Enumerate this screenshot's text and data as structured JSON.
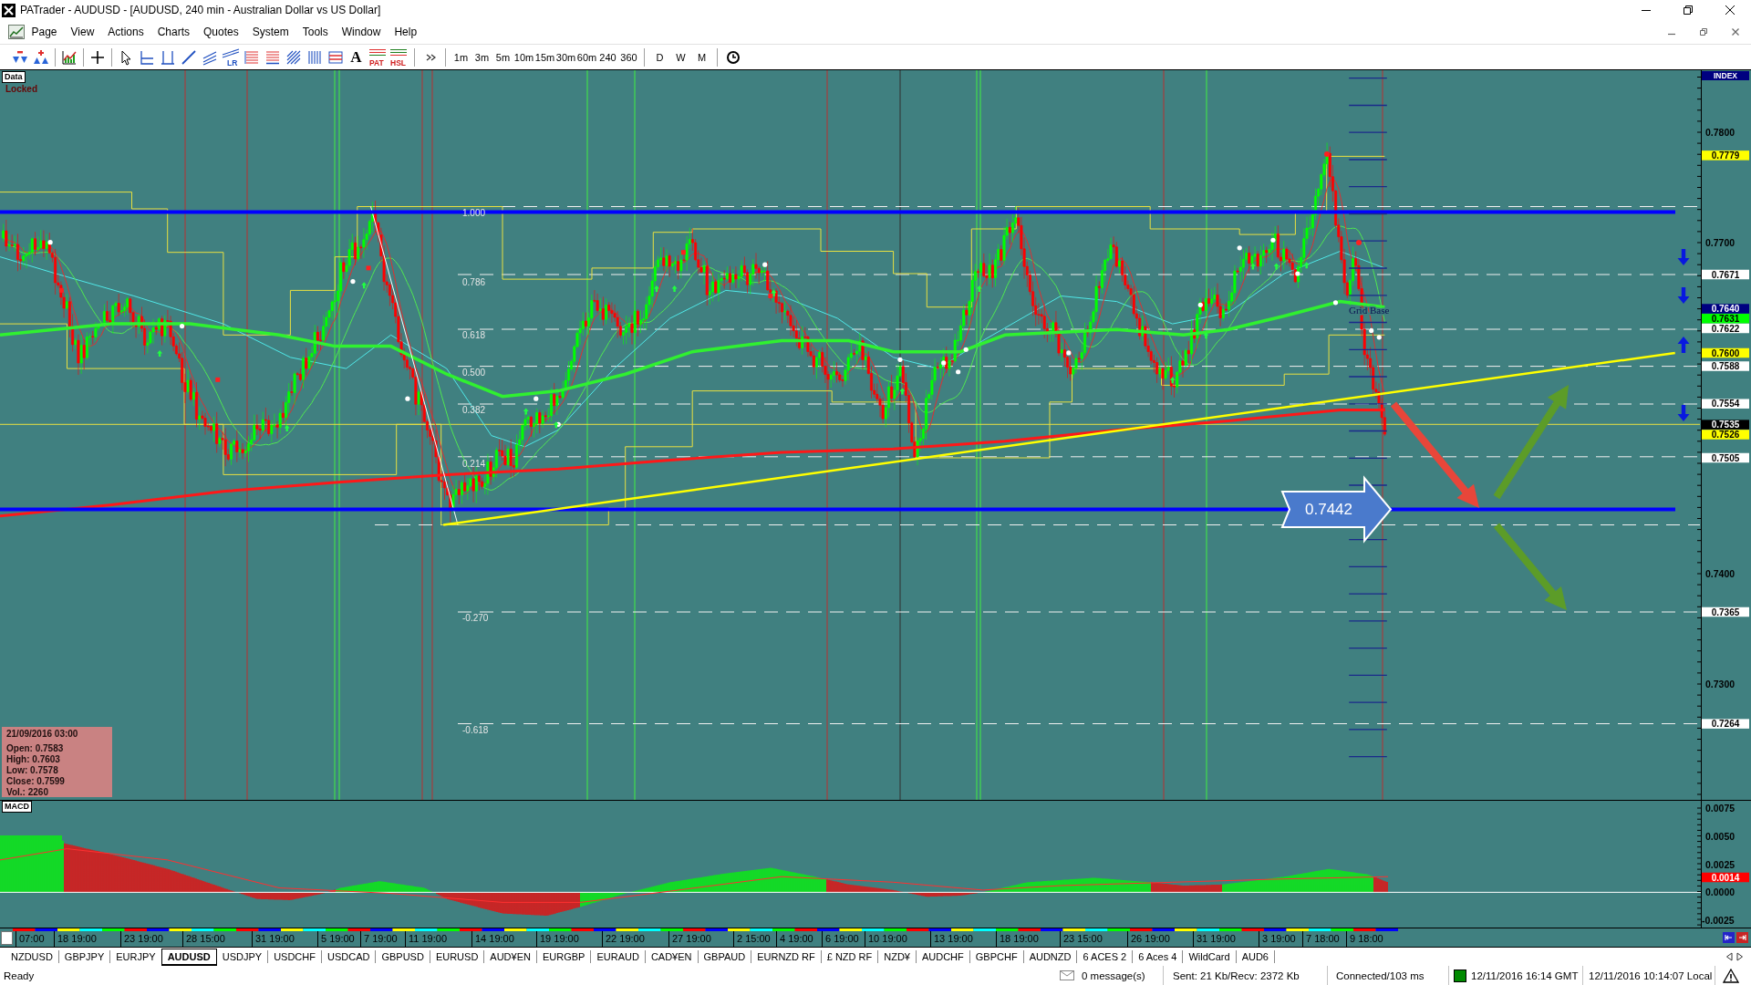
{
  "window": {
    "title": "PATrader - AUDUSD - [AUDUSD, 240 min - Australian Dollar vs US Dollar]"
  },
  "menu": [
    "Page",
    "View",
    "Actions",
    "Charts",
    "Quotes",
    "System",
    "Tools",
    "Window",
    "Help"
  ],
  "toolbar": {
    "icon_captions": [
      "LR",
      "PAT",
      "HSL"
    ],
    "text_tool": "A",
    "timeframes": [
      "1m",
      "3m",
      "5m",
      "10m",
      "15m",
      "30m",
      "60m",
      "240",
      "360"
    ],
    "periods": [
      "D",
      "W",
      "M"
    ]
  },
  "chart": {
    "corner_label": "Data",
    "lock_status": "Locked",
    "index_label": "INDEX",
    "price_ticks": [
      "0.7800",
      "0.7700",
      "0.7400",
      "0.7300"
    ],
    "price_tags": [
      {
        "label": "0.7779",
        "color": "#ffff00"
      },
      {
        "label": "0.7671",
        "color": "#ffffff"
      },
      {
        "label": "0.7640",
        "color": "#000080"
      },
      {
        "label": "0.7631",
        "color": "#00ff00"
      },
      {
        "label": "0.7622",
        "color": "#ffffff"
      },
      {
        "label": "0.7600",
        "color": "#ffff00"
      },
      {
        "label": "0.7588",
        "color": "#ffffff"
      },
      {
        "label": "0.7554",
        "color": "#ffffff"
      },
      {
        "label": "0.7535",
        "color": "#000000"
      },
      {
        "label": "0.7526",
        "color": "#ffff00"
      },
      {
        "label": "0.7505",
        "color": "#ffffff"
      },
      {
        "label": "0.7365",
        "color": "#ffffff"
      },
      {
        "label": "0.7264",
        "color": "#ffffff"
      }
    ],
    "fib_levels": [
      "1.000",
      "0.786",
      "0.618",
      "0.500",
      "0.382",
      "0.214",
      "-0.270",
      "-0.618"
    ],
    "grid_label": "Grid Base",
    "callout": "0.7442",
    "ohlc": {
      "date": "21/09/2016 03:00",
      "lines": [
        "Open: 0.7583",
        "High: 0.7603",
        "Low: 0.7578",
        "Close: 0.7599",
        "Vol.: 2260"
      ]
    }
  },
  "macd": {
    "label": "MACD",
    "ticks": [
      "0.0075",
      "0.0050",
      "0.0025",
      "0.0000",
      "-0.0025"
    ],
    "tags": [
      {
        "label": "0.0014",
        "color": "#ff0000"
      }
    ]
  },
  "time_axis": [
    "07:00",
    "18 19:00",
    "23 19:00",
    "28 15:00",
    "31 19:00",
    "5 19:00",
    "7 19:00",
    "11 19:00",
    "14 19:00",
    "19 19:00",
    "22 19:00",
    "27 19:00",
    "2 15:00",
    "4 19:00",
    "6 19:00",
    "10 19:00",
    "13 19:00",
    "18 19:00",
    "23 15:00",
    "26 19:00",
    "31 19:00",
    "3 19:00",
    "7 18:00",
    "9 18:00"
  ],
  "tabs": [
    {
      "label": "NZDUSD",
      "selected": false
    },
    {
      "label": "GBPJPY",
      "selected": false
    },
    {
      "label": "EURJPY",
      "selected": false
    },
    {
      "label": "AUDUSD",
      "selected": true
    },
    {
      "label": "USDJPY",
      "selected": false
    },
    {
      "label": "USDCHF",
      "selected": false
    },
    {
      "label": "USDCAD",
      "selected": false
    },
    {
      "label": "GBPUSD",
      "selected": false
    },
    {
      "label": "EURUSD",
      "selected": false
    },
    {
      "label": "AUD¥EN",
      "selected": false
    },
    {
      "label": "EURGBP",
      "selected": false
    },
    {
      "label": "EURAUD",
      "selected": false
    },
    {
      "label": "CAD¥EN",
      "selected": false
    },
    {
      "label": "GBPAUD",
      "selected": false
    },
    {
      "label": "EURNZD RF",
      "selected": false
    },
    {
      "label": "£ NZD RF",
      "selected": false
    },
    {
      "label": "NZD¥",
      "selected": false
    },
    {
      "label": "AUDCHF",
      "selected": false
    },
    {
      "label": "GBPCHF",
      "selected": false
    },
    {
      "label": "AUDNZD",
      "selected": false
    },
    {
      "label": "6 ACES 2",
      "selected": false
    },
    {
      "label": "6 Aces 4",
      "selected": false
    },
    {
      "label": "WildCard",
      "selected": false
    },
    {
      "label": "AUD6",
      "selected": false
    }
  ],
  "status_bar": {
    "state": "Ready",
    "messages": "0 message(s)",
    "traffic": "Sent: 21 Kb/Recv: 2372 Kb",
    "connection": "Connected/103 ms",
    "gmt_time": "12/11/2016 16:14 GMT",
    "local_time": "12/11/2016 10:14:07 Local"
  }
}
